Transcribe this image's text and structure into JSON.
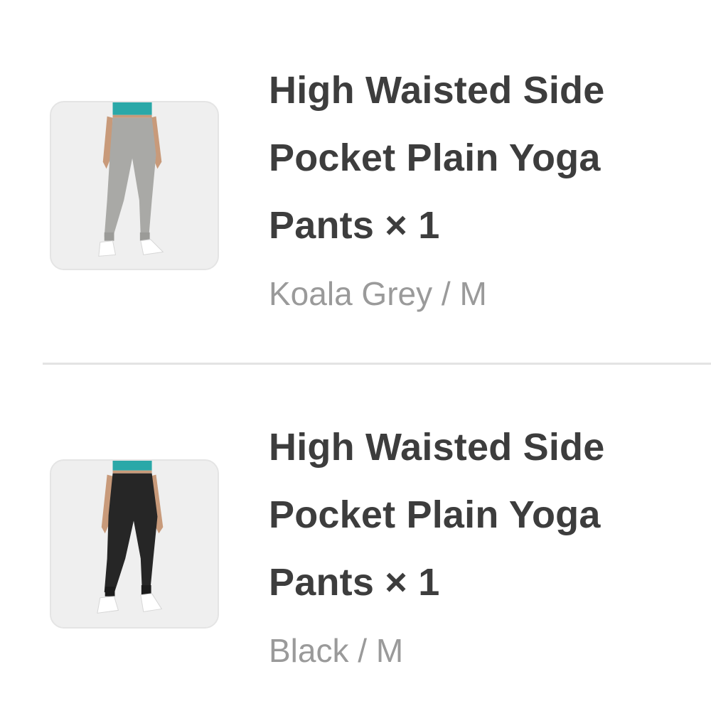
{
  "order_items": [
    {
      "title": "High Waisted Side Pocket Plain Yoga Pants × 1",
      "variant": "Koala Grey / M",
      "pants_color": "#a9a9a6",
      "image_icon": "yoga-pants-grey-product-image"
    },
    {
      "title": "High Waisted Side Pocket Plain Yoga Pants × 1",
      "variant": "Black / M",
      "pants_color": "#262626",
      "image_icon": "yoga-pants-black-product-image"
    }
  ],
  "colors": {
    "title": "#3d3d3d",
    "variant": "#9a9a9a",
    "divider": "#e3e3e3",
    "top_teal": "#2aa8a8"
  }
}
